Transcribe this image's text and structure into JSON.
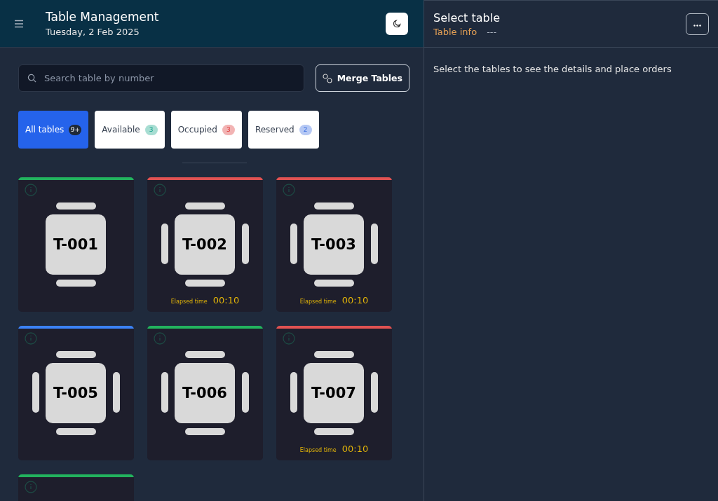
{
  "header": {
    "title": "Table Management",
    "date": "Tuesday, 2 Feb 2025"
  },
  "search": {
    "placeholder": "Search table by number"
  },
  "merge_button": {
    "label": "Merge Tables"
  },
  "filters": [
    {
      "label": "All tables",
      "count": "9+",
      "kind": "all",
      "selected": true
    },
    {
      "label": "Available",
      "count": "3",
      "kind": "available",
      "selected": false
    },
    {
      "label": "Occupied",
      "count": "3",
      "kind": "occupied",
      "selected": false
    },
    {
      "label": "Reserved",
      "count": "2",
      "kind": "reserved",
      "selected": false
    }
  ],
  "tables": [
    {
      "label": "T-001",
      "kind": "available",
      "side_seats": false
    },
    {
      "label": "T-002",
      "kind": "occupied",
      "side_seats": true,
      "elapsed_label": "Elapsed time",
      "elapsed": "00:10"
    },
    {
      "label": "T-003",
      "kind": "occupied",
      "side_seats": true,
      "elapsed_label": "Elapsed time",
      "elapsed": "00:10"
    },
    {
      "label": "T-005",
      "kind": "reserved",
      "side_seats": true
    },
    {
      "label": "T-006",
      "kind": "available",
      "side_seats": true
    },
    {
      "label": "T-007",
      "kind": "occupied",
      "side_seats": true,
      "elapsed_label": "Elapsed time",
      "elapsed": "00:10"
    },
    {
      "kind": "available"
    }
  ],
  "details": {
    "title": "Select table",
    "info_label": "Table info",
    "info_value": "---",
    "message": "Select the tables to see the details and place orders"
  }
}
